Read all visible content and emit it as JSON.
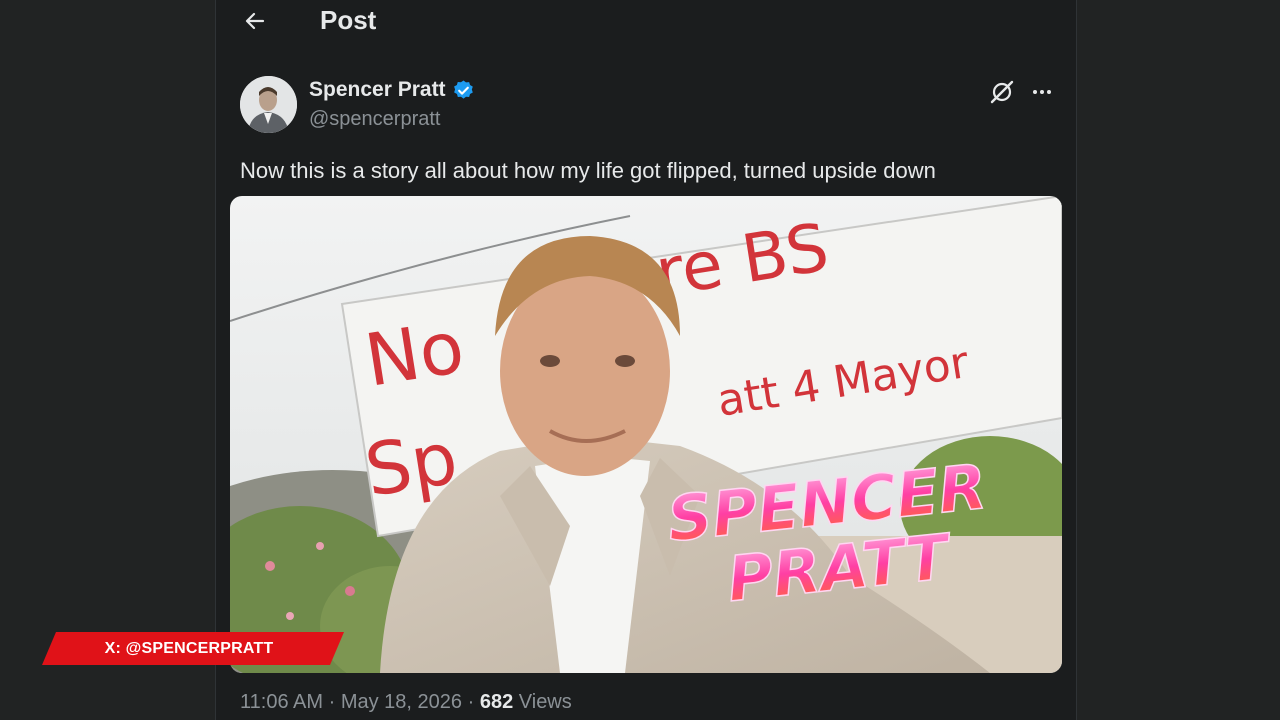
{
  "header": {
    "back_icon": "arrow-left-icon",
    "title": "Post"
  },
  "author": {
    "display_name": "Spencer Pratt",
    "handle": "@spencerpratt",
    "verified": true,
    "verified_color": "#1d9bf0"
  },
  "actions": {
    "grok_icon": "grok-icon",
    "more_icon": "more-horizontal-icon"
  },
  "post": {
    "text": "Now this is a story all about how my life got flipped, turned upside down",
    "media": {
      "sign_text": "No more BS Spencer Pratt 4 Mayor",
      "overlay_title": "SPENCER PRATT"
    },
    "meta": {
      "time": "11:06 AM",
      "separator": "·",
      "date": "May 18, 2026",
      "views_count": "682",
      "views_label": "Views"
    }
  },
  "overlay": {
    "lower_third_text": "X: @SPENCERPRATT",
    "lower_third_color": "#e01218"
  },
  "colors": {
    "background": "#212323",
    "column": "#1b1d1e",
    "text_primary": "#e7e9ea",
    "text_secondary": "#8b9196"
  }
}
